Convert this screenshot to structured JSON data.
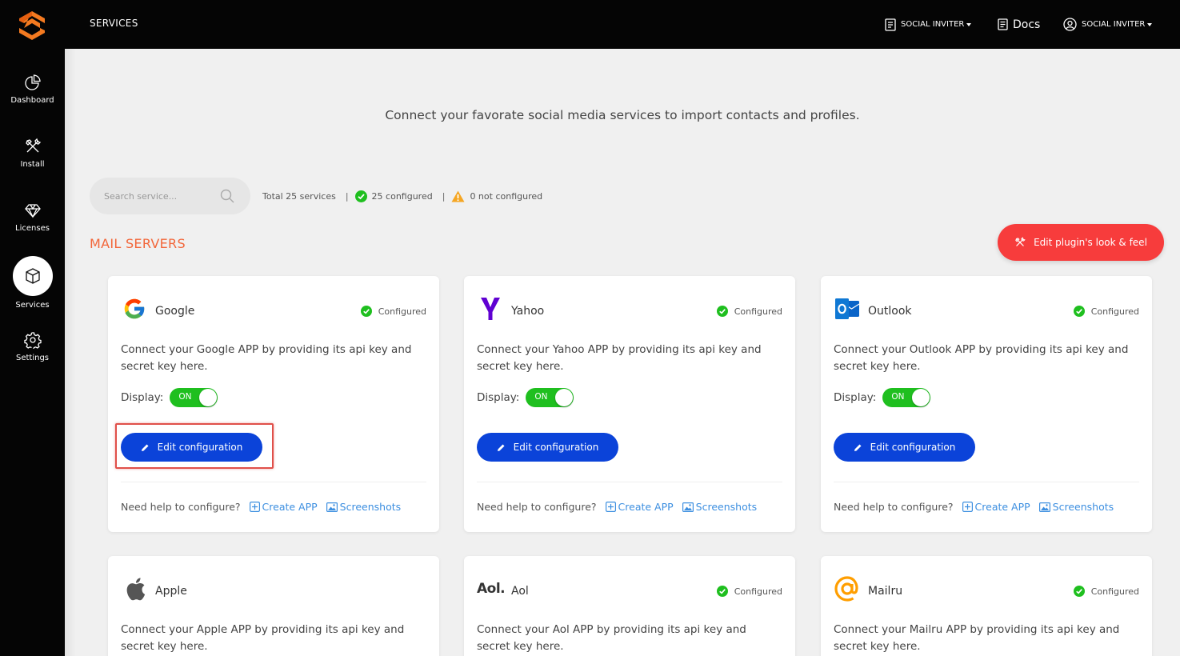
{
  "sidebar": {
    "items": [
      {
        "label": "Dashboard",
        "icon": "pie-chart-icon"
      },
      {
        "label": "Install",
        "icon": "tools-icon"
      },
      {
        "label": "Licenses",
        "icon": "diamond-icon"
      },
      {
        "label": "Services",
        "icon": "box-icon",
        "active": true
      },
      {
        "label": "Settings",
        "icon": "gear-icon"
      }
    ]
  },
  "header": {
    "title": "SERVICES",
    "menu_project": "SOCIAL INVITER",
    "docs": "Docs",
    "menu_user": "SOCIAL INVITER"
  },
  "main": {
    "subtitle": "Connect your favorate social media services to import contacts and profiles.",
    "search_placeholder": "Search service...",
    "stats": {
      "total": "Total 25 services",
      "configured": "25 configured",
      "not_configured": "0 not configured"
    },
    "section_title": "MAIL SERVERS",
    "look_button": "Edit plugin's look & feel"
  },
  "colors": {
    "accent": "#f2663a",
    "primary": "#0b43d9",
    "danger": "#f73c3c",
    "success": "#1fbf1f",
    "link": "#3d8fe0"
  },
  "common": {
    "configured": "Configured",
    "display_label": "Display:",
    "toggle_on": "ON",
    "edit_label": "Edit configuration",
    "help_label": "Need help to configure?",
    "create_app": "Create APP",
    "screenshots": "Screenshots"
  },
  "services": [
    {
      "name": "Google",
      "description": "Connect your Google APP by providing its api key and secret key here."
    },
    {
      "name": "Yahoo",
      "description": "Connect your Yahoo APP by providing its api key and secret key here."
    },
    {
      "name": "Outlook",
      "description": "Connect your Outlook APP by providing its api key and secret key here."
    },
    {
      "name": "Apple",
      "description": "Connect your Apple APP by providing its api key and secret key here."
    },
    {
      "name": "Aol",
      "logo_text": "Aol.",
      "description": "Connect your Aol APP by providing its api key and secret key here."
    },
    {
      "name": "Mailru",
      "description": "Connect your Mailru APP by providing its api key and secret key here."
    }
  ]
}
